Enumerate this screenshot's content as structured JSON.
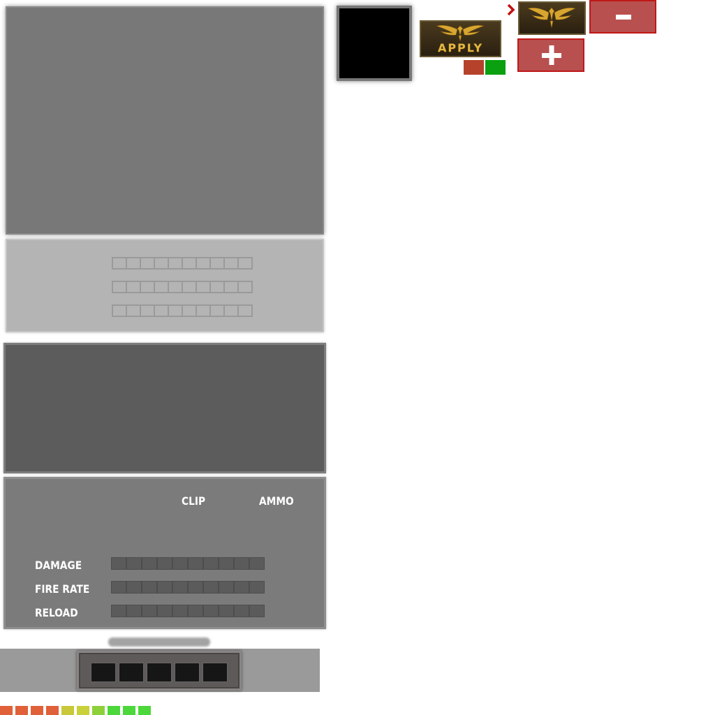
{
  "weapon_panel": {
    "clip_label": "CLIP",
    "ammo_label": "AMMO",
    "stats": [
      {
        "label": "DAMAGE"
      },
      {
        "label": "FIRE RATE"
      },
      {
        "label": "RELOAD"
      }
    ]
  },
  "apply_button": {
    "label": "APPLY"
  },
  "emblem_button": {
    "icon": "eagle-emblem-icon"
  },
  "minus_button": {
    "icon": "minus-icon"
  },
  "plus_button": {
    "icon": "plus-icon"
  },
  "arrow": {
    "icon": "chevron-right-icon"
  },
  "hotbar": {
    "slot_count": 5
  },
  "color_ramp": [
    "#e0603a",
    "#e0603a",
    "#e0603a",
    "#e0603a",
    "#c8c83a",
    "#c8d03a",
    "#8ed03a",
    "#4cd83a",
    "#4cd83a",
    "#4cd83a"
  ],
  "colors": {
    "accent_red": "#b85050",
    "accent_red_border": "#c01818",
    "gold": "#e4b640",
    "chip_red": "#b6422c",
    "chip_green": "#0aa010"
  }
}
